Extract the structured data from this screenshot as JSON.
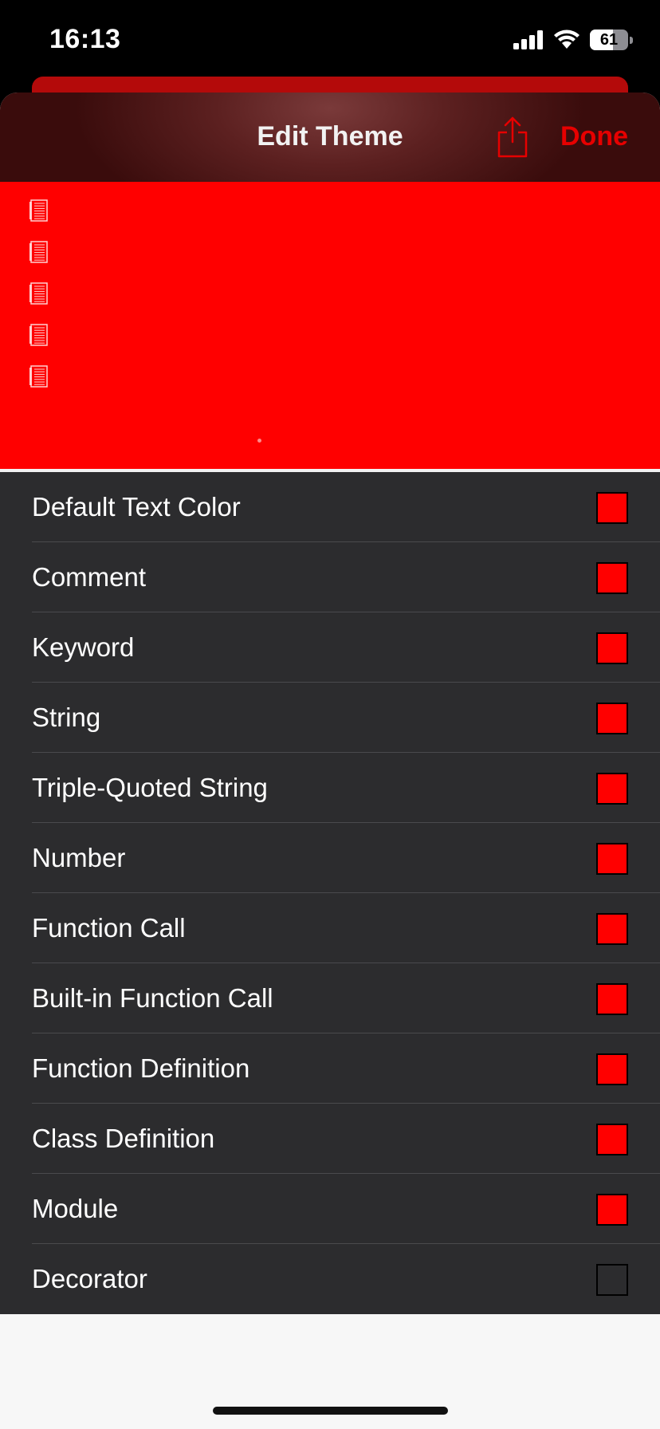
{
  "status_bar": {
    "time": "16:13",
    "battery_percent": "61",
    "battery_level": 0.61
  },
  "nav": {
    "title": "Edit Theme",
    "done_label": "Done",
    "share_icon": "share-icon",
    "accent_color": "#e60000"
  },
  "preview": {
    "background_color": "#ff0000",
    "line_icons": 5
  },
  "color_rows": [
    {
      "label": "Default Text Color",
      "color": "#ff0000"
    },
    {
      "label": "Comment",
      "color": "#ff0000"
    },
    {
      "label": "Keyword",
      "color": "#ff0000"
    },
    {
      "label": "String",
      "color": "#ff0000"
    },
    {
      "label": "Triple-Quoted String",
      "color": "#ff0000"
    },
    {
      "label": "Number",
      "color": "#ff0000"
    },
    {
      "label": "Function Call",
      "color": "#ff0000"
    },
    {
      "label": "Built-in Function Call",
      "color": "#ff0000"
    },
    {
      "label": "Function Definition",
      "color": "#ff0000"
    },
    {
      "label": "Class Definition",
      "color": "#ff0000"
    },
    {
      "label": "Module",
      "color": "#ff0000"
    },
    {
      "label": "Decorator",
      "color": null
    }
  ]
}
